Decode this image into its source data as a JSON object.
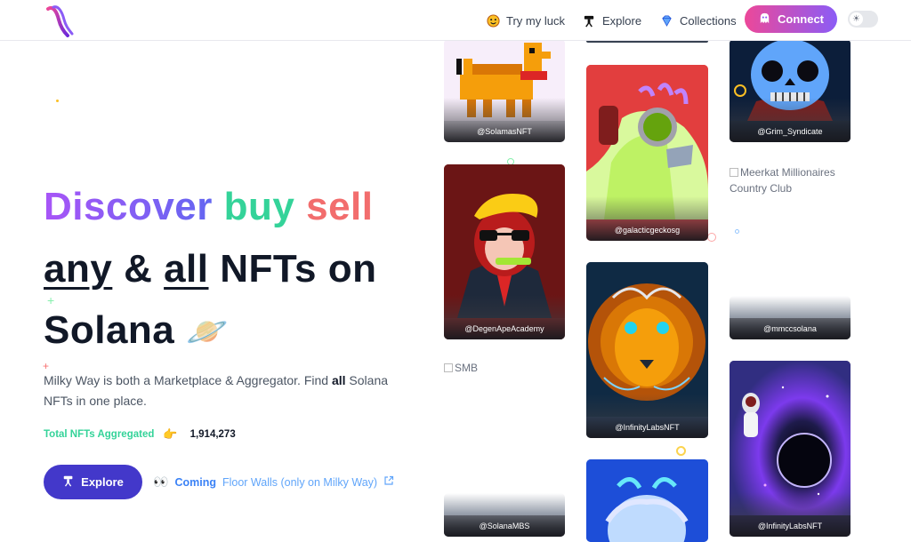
{
  "header": {
    "nav": [
      {
        "label": "Try my luck",
        "icon": "dice-face-icon"
      },
      {
        "label": "Explore",
        "icon": "telescope-icon"
      },
      {
        "label": "Collections",
        "icon": "diamond-icon"
      }
    ],
    "connect_label": "Connect",
    "theme_toggle_icon": "sun-icon"
  },
  "hero": {
    "word_discover": "Discover",
    "word_buy": "buy",
    "word_sell": "sell",
    "word_any": "any",
    "word_amp": "&",
    "word_all": "all",
    "word_nfts_on": "NFTs on",
    "word_solana": "Solana",
    "planet_emoji": "🪐",
    "desc_before": "Milky Way is both a Marketplace & Aggregator. Find ",
    "desc_bold": "all",
    "desc_after": " Solana NFTs in one place.",
    "stats_label": "Total NFTs Aggregated",
    "stats_emoji": "👉",
    "stats_value": "1,914,273",
    "explore_label": "Explore",
    "coming_emoji": "👀",
    "coming_label": "Coming",
    "coming_text": "Floor Walls (only on Milky Way)"
  },
  "cards": [
    {
      "label": "@SolamasNFT"
    },
    {
      "label": "@galacticgeckosg"
    },
    {
      "label": "@Grim_Syndicate"
    },
    {
      "label": "@DegenApeAcademy"
    },
    {
      "label": "@mmccsolana"
    },
    {
      "label": "@InfinityLabsNFT"
    },
    {
      "label": "@SolanaMBS"
    },
    {
      "label": "@InfinityLabsNFT"
    }
  ],
  "broken_images": {
    "meerkat_alt": "Meerkat Millionaires Country Club",
    "smb_alt": "SMB"
  },
  "colors": {
    "accent_purple": "#8b5cf6",
    "accent_green": "#34d399",
    "accent_red": "#f26d6d",
    "explore_button": "#4338ca",
    "connect_gradient_start": "#ec4899",
    "connect_gradient_end": "#8b5cf6"
  }
}
